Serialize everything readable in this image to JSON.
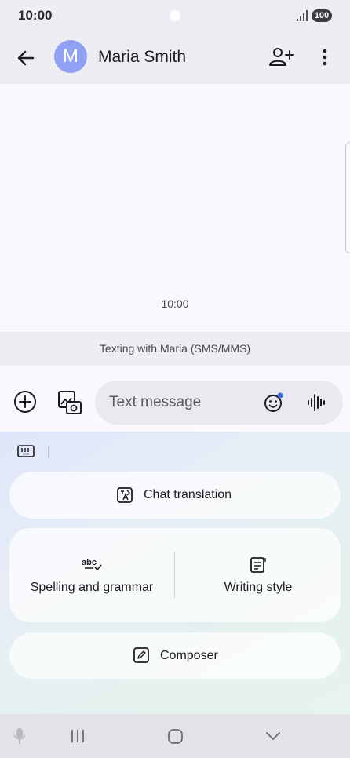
{
  "status_bar": {
    "time": "10:00",
    "battery": "100"
  },
  "header": {
    "avatar_letter": "M",
    "contact_name": "Maria Smith"
  },
  "conversation": {
    "message_time": "10:00",
    "texting_label": "Texting with Maria (SMS/MMS)"
  },
  "compose": {
    "placeholder": "Text message"
  },
  "ai_panel": {
    "chat_translation": "Chat translation",
    "spelling_grammar": "Spelling and grammar",
    "writing_style": "Writing style",
    "composer": "Composer"
  },
  "icons": {
    "back": "arrow-left-icon",
    "add_contact": "person-add-icon",
    "more": "more-vert-icon",
    "add": "plus-circle-icon",
    "gallery": "gallery-icon",
    "emoji": "emoji-icon",
    "voice": "waveform-icon",
    "keyboard": "keyboard-icon",
    "translate": "translate-icon",
    "spelling": "spell-check-icon",
    "writing": "writing-style-icon",
    "composer": "pencil-icon",
    "mic": "mic-icon",
    "recents": "recents-icon",
    "home": "home-icon",
    "hide": "chevron-down-icon"
  },
  "colors": {
    "accent": "#8fa0f5",
    "header_bg": "#eeedf3",
    "notification_dot": "#3f6ad8"
  }
}
